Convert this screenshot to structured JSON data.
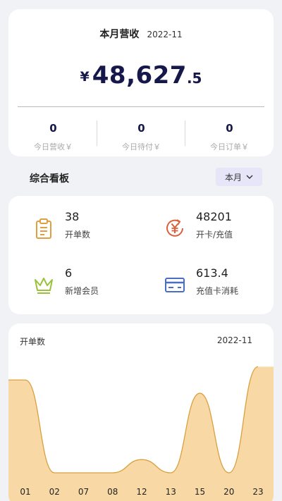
{
  "revenue": {
    "title": "本月营收",
    "date": "2022-11",
    "currency": "¥",
    "amount_int": "48,627",
    "amount_dec": ".5",
    "stats": [
      {
        "value": "0",
        "label": "今日营收￥"
      },
      {
        "value": "0",
        "label": "今日待付￥"
      },
      {
        "value": "0",
        "label": "今日订单￥"
      }
    ]
  },
  "dashboard": {
    "title": "综合看板",
    "period": "本月"
  },
  "metrics": [
    {
      "value": "38",
      "label": "开单数",
      "icon": "clipboard-icon",
      "color": "#e0a040"
    },
    {
      "value": "48201",
      "label": "开卡/充值",
      "icon": "yuan-refresh-icon",
      "color": "#d9603a"
    },
    {
      "value": "6",
      "label": "新增会员",
      "icon": "crown-icon",
      "color": "#9bc23c"
    },
    {
      "value": "613.4",
      "label": "充值卡消耗",
      "icon": "card-icon",
      "color": "#4a6fc2"
    }
  ],
  "chart_data": {
    "type": "area",
    "title": "开单数",
    "date": "2022-11",
    "categories": [
      "01",
      "02",
      "07",
      "08",
      "12",
      "13",
      "15",
      "20",
      "23"
    ],
    "values": [
      7,
      0,
      0,
      0,
      1,
      0,
      6,
      0,
      8
    ],
    "ylim": [
      0,
      8.5
    ],
    "fill_color": "#f8d9a6",
    "line_color": "#d9a040"
  }
}
